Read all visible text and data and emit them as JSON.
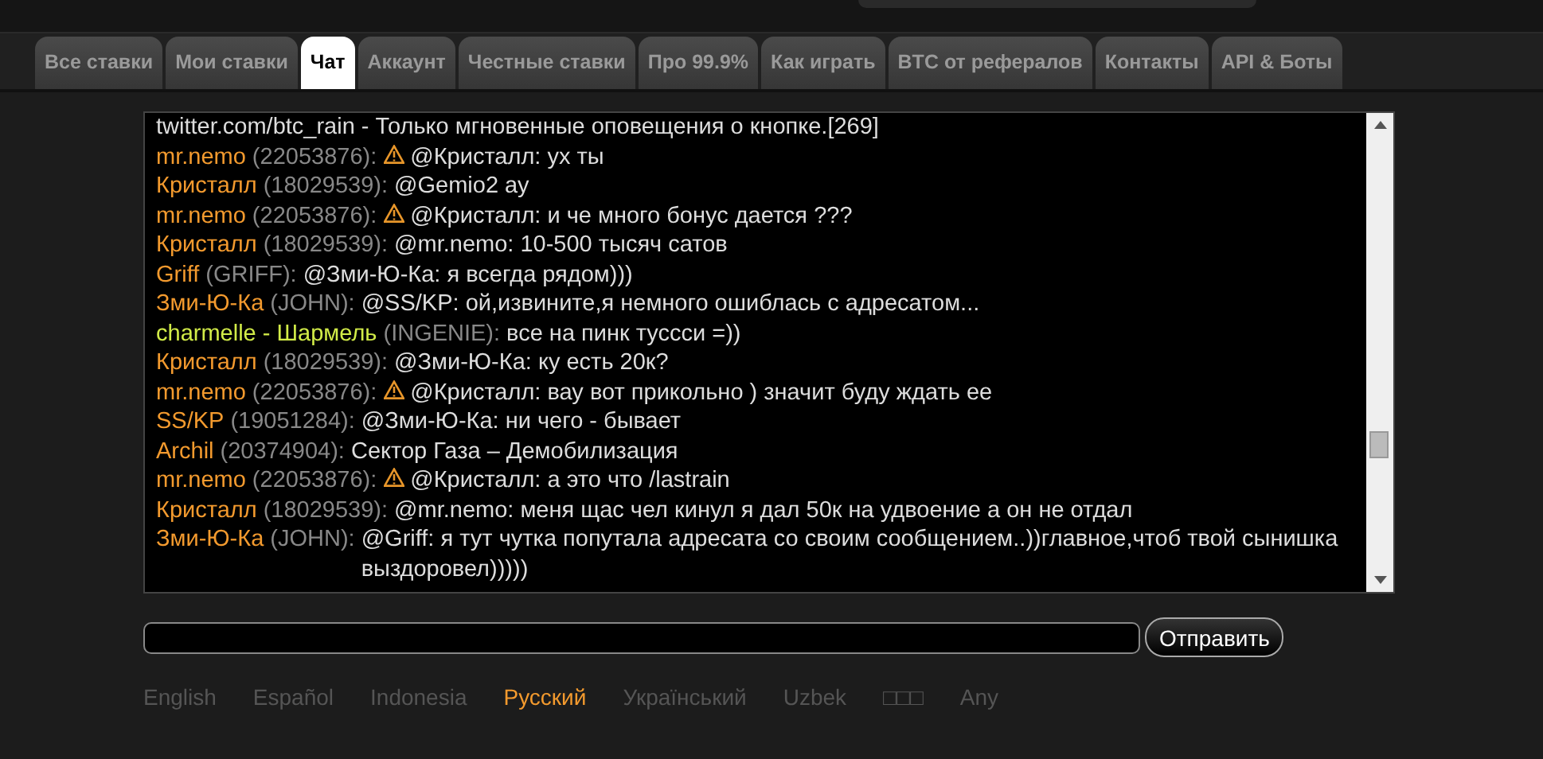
{
  "tabs": [
    {
      "label": "Все ставки",
      "selected": false
    },
    {
      "label": "Мои ставки",
      "selected": false
    },
    {
      "label": "Чат",
      "selected": true
    },
    {
      "label": "Аккаунт",
      "selected": false
    },
    {
      "label": "Честные ставки",
      "selected": false
    },
    {
      "label": "Про 99.9%",
      "selected": false
    },
    {
      "label": "Как играть",
      "selected": false
    },
    {
      "label": "BTC от рефералов",
      "selected": false
    },
    {
      "label": "Контакты",
      "selected": false
    },
    {
      "label": "API & Боты",
      "selected": false
    }
  ],
  "chat": {
    "messages": [
      {
        "kind": "system",
        "text": "twitter.com/btc_rain - Только мгновенные оповещения о кнопке.[269]"
      },
      {
        "kind": "user",
        "name": "mr.nemo",
        "id": "(22053876):",
        "color": "#f39a2e",
        "warning": true,
        "text": "@Кристалл: ух ты"
      },
      {
        "kind": "user",
        "name": "Кристалл",
        "id": "(18029539):",
        "color": "#f39a2e",
        "warning": false,
        "text": "@Gemio2 ау"
      },
      {
        "kind": "user",
        "name": "mr.nemo",
        "id": "(22053876):",
        "color": "#f39a2e",
        "warning": true,
        "text": "@Кристалл: и че много бонус дается ???"
      },
      {
        "kind": "user",
        "name": "Кристалл",
        "id": "(18029539):",
        "color": "#f39a2e",
        "warning": false,
        "text": "@mr.nemo: 10-500 тысяч сатов"
      },
      {
        "kind": "user",
        "name": "Griff",
        "id": "(GRIFF):",
        "color": "#f39a2e",
        "warning": false,
        "text": "@Зми-Ю-Ка: я всегда рядом)))"
      },
      {
        "kind": "user",
        "name": "Зми-Ю-Ка",
        "id": "(JOHN):",
        "color": "#f39a2e",
        "warning": false,
        "text": "@SS/KP: ой,извините,я немного ошиблась с адресатом..."
      },
      {
        "kind": "user",
        "name": "charmelle - Шармель",
        "id": "(INGENIE):",
        "color": "#d2ec48",
        "warning": false,
        "text": "все на пинк туссси =))"
      },
      {
        "kind": "user",
        "name": "Кристалл",
        "id": "(18029539):",
        "color": "#f39a2e",
        "warning": false,
        "text": "@Зми-Ю-Ка: ку есть 20к?"
      },
      {
        "kind": "user",
        "name": "mr.nemo",
        "id": "(22053876):",
        "color": "#f39a2e",
        "warning": true,
        "text": "@Кристалл: вау вот прикольно ) значит буду ждать ее"
      },
      {
        "kind": "user",
        "name": "SS/KP",
        "id": "(19051284):",
        "color": "#f39a2e",
        "warning": false,
        "text": "@Зми-Ю-Ка: ни чего - бывает"
      },
      {
        "kind": "user",
        "name": "Archil",
        "id": "(20374904):",
        "color": "#f39a2e",
        "warning": false,
        "text": "Сектор Газа – Демобилизация"
      },
      {
        "kind": "user",
        "name": "mr.nemo",
        "id": "(22053876):",
        "color": "#f39a2e",
        "warning": true,
        "text": "@Кристалл: а это что /lastrain"
      },
      {
        "kind": "user",
        "name": "Кристалл",
        "id": "(18029539):",
        "color": "#f39a2e",
        "warning": false,
        "text": "@mr.nemo: меня щас чел кинул я дал 50к на удвоение а он не отдал"
      },
      {
        "kind": "user",
        "name": "Зми-Ю-Ка",
        "id": "(JOHN):",
        "color": "#f39a2e",
        "warning": false,
        "text": "@Griff: я тут чутка попутала адресата со своим сообщением..))главное,чтоб твой сынишка выздоровел)))))"
      }
    ],
    "send_button": "Отправить"
  },
  "languages": [
    {
      "label": "English",
      "selected": false
    },
    {
      "label": "Español",
      "selected": false
    },
    {
      "label": "Indonesia",
      "selected": false
    },
    {
      "label": "Русский",
      "selected": true
    },
    {
      "label": "Український",
      "selected": false
    },
    {
      "label": "Uzbek",
      "selected": false
    },
    {
      "label": "□□□",
      "selected": false
    },
    {
      "label": "Any",
      "selected": false
    }
  ]
}
